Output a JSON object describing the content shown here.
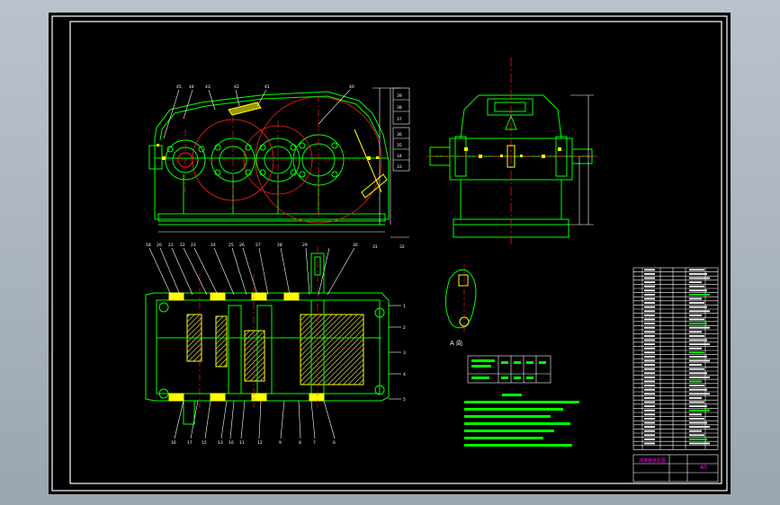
{
  "drawing": {
    "view_label": "A 向",
    "colors": {
      "frame": "#ffffff",
      "outline": "#00ff00",
      "centerline": "#ff2020",
      "highlight": "#ffff00",
      "hatch": "#ffff66",
      "cyan": "#00ffff",
      "magenta": "#ff00ff",
      "dimension": "#ffffff"
    },
    "part_numbers_top": [
      "45",
      "44",
      "43",
      "42",
      "41",
      "40"
    ],
    "part_numbers_plan_top": [
      "18",
      "20",
      "21",
      "22",
      "23",
      "24",
      "25",
      "26",
      "27",
      "28",
      "29",
      "30"
    ],
    "part_numbers_plan_bottom": [
      "16",
      "17",
      "15",
      "13",
      "10",
      "11",
      "12",
      "9",
      "8",
      "7",
      "6"
    ],
    "part_numbers_right": [
      "39",
      "38",
      "37",
      "36",
      "35",
      "34",
      "33",
      "32",
      "31"
    ],
    "part_numbers_plan_right": [
      "1",
      "2",
      "3",
      "4",
      "5"
    ],
    "title_block": {
      "scale_note": "A0",
      "title": "减速器装配图"
    }
  }
}
